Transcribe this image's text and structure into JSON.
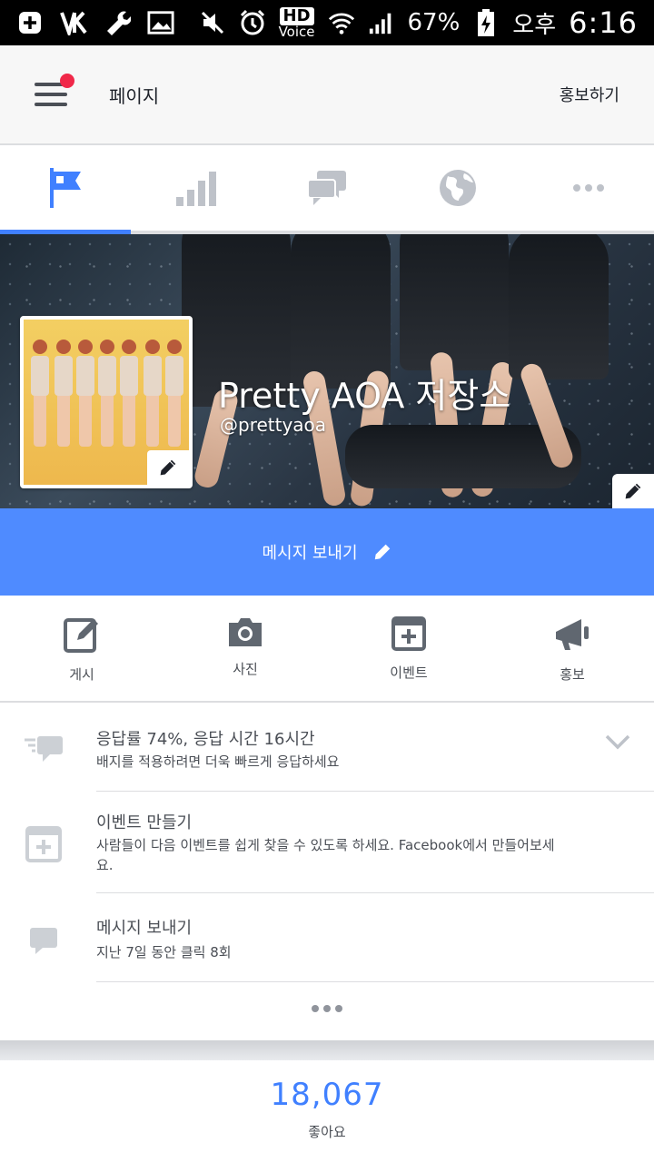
{
  "status_bar": {
    "battery": "67%",
    "am_pm": "오후",
    "time": "6:16",
    "hd": "HD",
    "voice": "Voice"
  },
  "header": {
    "title": "페이지",
    "promote": "홍보하기"
  },
  "tabs": [
    {
      "icon": "flag-icon",
      "active": true
    },
    {
      "icon": "bar-chart-icon",
      "active": false
    },
    {
      "icon": "messages-icon",
      "active": false
    },
    {
      "icon": "globe-icon",
      "active": false
    },
    {
      "icon": "more-icon",
      "active": false
    }
  ],
  "profile": {
    "name": "Pretty AOA 저장소",
    "handle": "@prettyaoa"
  },
  "message_button": {
    "label": "메시지 보내기"
  },
  "actions": [
    {
      "label": "게시",
      "icon": "compose-icon"
    },
    {
      "label": "사진",
      "icon": "camera-icon"
    },
    {
      "label": "이벤트",
      "icon": "calendar-plus-icon"
    },
    {
      "label": "홍보",
      "icon": "megaphone-icon"
    }
  ],
  "insights": [
    {
      "title": "응답률 74%, 응답 시간 16시간",
      "subtitle": "배지를 적용하려면 더욱 빠르게 응답하세요"
    },
    {
      "title": "이벤트 만들기",
      "subtitle": "사람들이 다음 이벤트를 쉽게 찾을 수 있도록 하세요. Facebook에서 만들어보세요."
    },
    {
      "title": "메시지 보내기",
      "subtitle": "지난 7일 동안 클릭 8회"
    }
  ],
  "likes": {
    "count": "18,067",
    "label": "좋아요"
  },
  "colors": {
    "accent": "#4080ff",
    "message_bar": "#4f8bff",
    "notification": "#f02849"
  }
}
